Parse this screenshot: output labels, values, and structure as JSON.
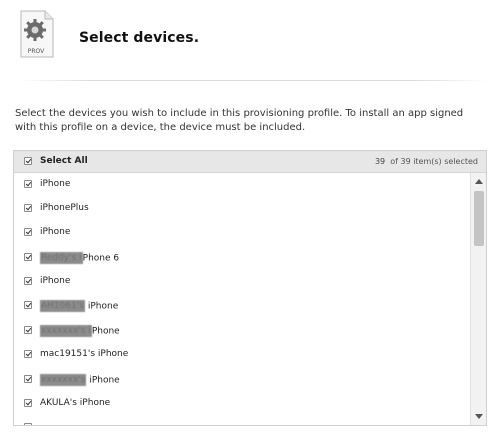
{
  "header": {
    "icon_text": "PROV",
    "icon": "provisioning-profile-gear-icon",
    "title": "Select devices."
  },
  "description": "Select the devices you wish to include in this provisioning profile. To install an app signed with this profile on a device, the device must be included.",
  "panel": {
    "select_all_label": "Select All",
    "selected_count": "39",
    "count_suffix": "of 39 item(s) selected"
  },
  "devices": [
    {
      "prefix": "",
      "redacted": "",
      "suffix": "iPhone",
      "checked": true
    },
    {
      "prefix": "",
      "redacted": "",
      "suffix": "iPhonePlus",
      "checked": true
    },
    {
      "prefix": "",
      "redacted": "",
      "suffix": "iPhone",
      "checked": true
    },
    {
      "prefix": "",
      "redacted": "Reddy's i",
      "suffix": "Phone 6",
      "checked": true
    },
    {
      "prefix": "",
      "redacted": "",
      "suffix": "iPhone",
      "checked": true
    },
    {
      "prefix": "",
      "redacted": "AH1061's",
      "suffix": " iPhone",
      "checked": true
    },
    {
      "prefix": "",
      "redacted": "xxxxxxx's i",
      "suffix": "Phone",
      "checked": true
    },
    {
      "prefix": "",
      "redacted": "",
      "suffix": "mac19151's iPhone",
      "checked": true
    },
    {
      "prefix": "",
      "redacted": "xxxxxxx's",
      "suffix": " iPhone",
      "checked": true
    },
    {
      "prefix": "",
      "redacted": "",
      "suffix": "AKULA's iPhone",
      "checked": true
    }
  ],
  "colors": {
    "panel_header_bg": "#e7e7e7",
    "panel_border": "#cfcfcf",
    "text": "#333333"
  }
}
